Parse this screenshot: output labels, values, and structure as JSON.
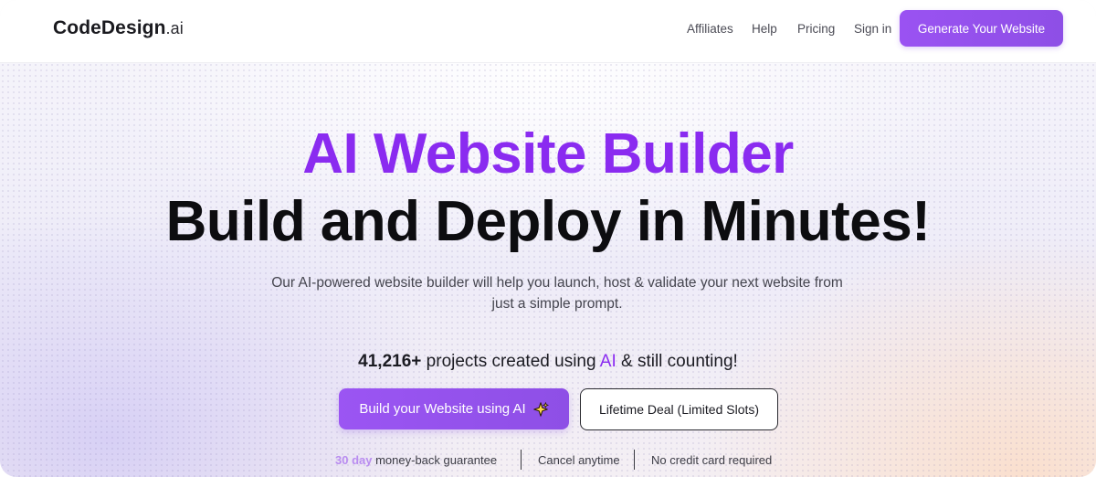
{
  "brand": {
    "name": "CodeDesign",
    "suffix": ".ai",
    "accent_color": "#8a2bf0",
    "button_color": "#9652f0"
  },
  "nav": {
    "links": [
      "Affiliates",
      "Help",
      "Pricing",
      "Sign in"
    ],
    "cta_label": "Generate Your Website"
  },
  "hero": {
    "title_line_1": "AI Website Builder",
    "title_line_2": "Build and Deploy in Minutes!",
    "subtitle_line_1": "Our AI-powered website builder will help you launch, host & validate your next website from",
    "subtitle_line_2": "just a simple prompt."
  },
  "stats": {
    "count": "41,216+",
    "text_before_ai": " projects created using ",
    "ai_word": "AI",
    "text_after_ai": " & still counting!"
  },
  "actions": {
    "primary_label": "Build your Website using AI",
    "primary_icon": "sparkle-icon",
    "secondary_label": "Lifetime Deal (Limited Slots)"
  },
  "guarantees": {
    "item1_accent": "30 day",
    "item1_rest": " money-back guarantee",
    "item2": "Cancel anytime",
    "item3": "No credit card required"
  }
}
